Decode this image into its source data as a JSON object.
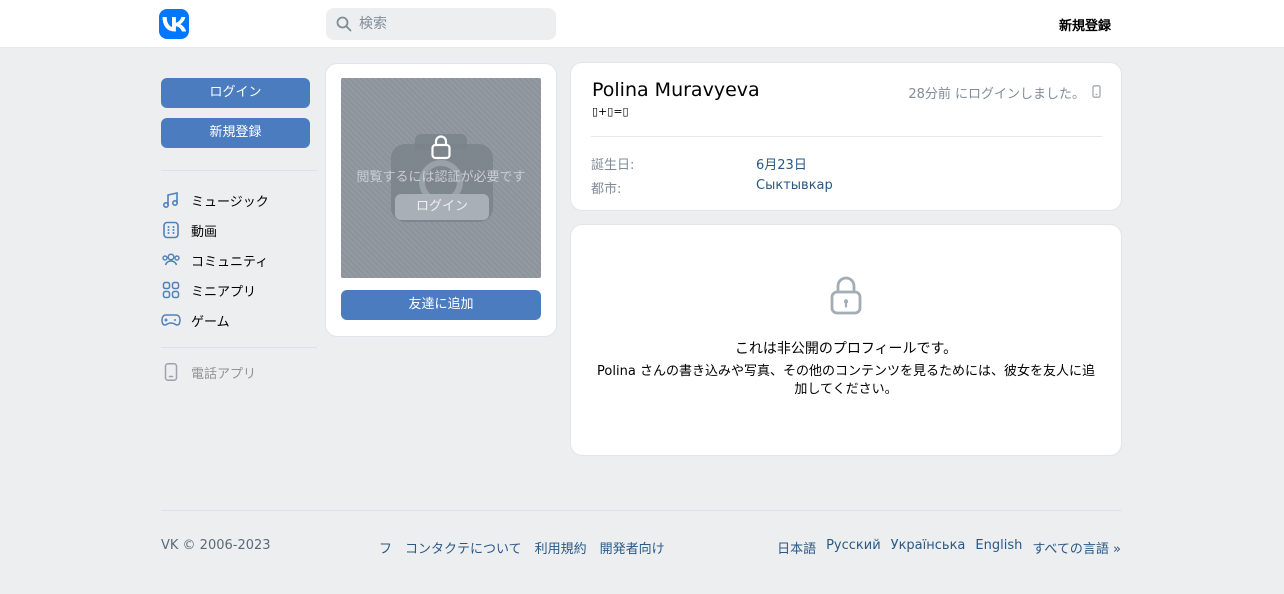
{
  "header": {
    "search_placeholder": "検索",
    "signup_label": "新規登録"
  },
  "sidebar": {
    "login_label": "ログイン",
    "signup_label": "新規登録",
    "items": [
      {
        "icon": "music-note-icon",
        "label": "ミュージック"
      },
      {
        "icon": "video-icon",
        "label": "動画"
      },
      {
        "icon": "users-icon",
        "label": "コミュニティ"
      },
      {
        "icon": "apps-grid-icon",
        "label": "ミニアプリ"
      },
      {
        "icon": "gamepad-icon",
        "label": "ゲーム"
      }
    ],
    "phone_app_label": "電話アプリ"
  },
  "photo_card": {
    "auth_text": "閲覧するには認証が必要です",
    "login_label": "ログイン",
    "add_friend_label": "友達に追加"
  },
  "profile": {
    "name": "Polina Muravyeva",
    "status": "▯+▯=▯",
    "last_seen": "28分前 にログインしました。",
    "birthday_label": "誕生日:",
    "birthday_value": "6月23日",
    "city_label": "都市:",
    "city_value": "Сыктывкар"
  },
  "private": {
    "title": "これは非公開のプロフィールです。",
    "description": "Polina さんの書き込みや写真、その他のコンテンツを見るためには、彼女を友人に追加してください。"
  },
  "footer": {
    "copyright": "VK © 2006-2023",
    "links": [
      "フ",
      "コンタクテについて",
      "利用規約",
      "開発者向け"
    ],
    "languages": [
      "日本語",
      "Русский",
      "Українська",
      "English",
      "すべての言語 »"
    ]
  },
  "colors": {
    "accent": "#4a7cbf",
    "link": "#2a5885",
    "logo": "#0077ff",
    "background": "#edeef0"
  }
}
